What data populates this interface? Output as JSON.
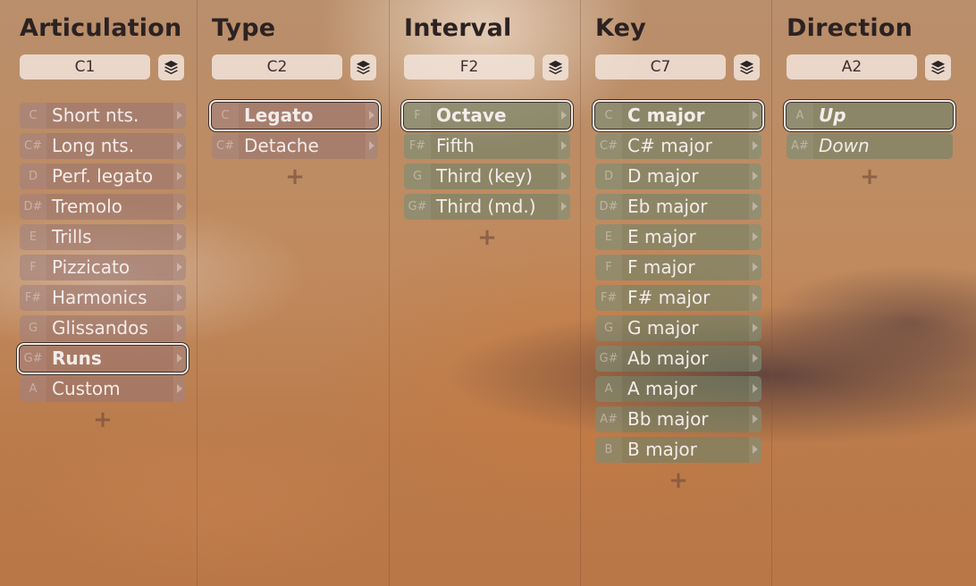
{
  "columns": [
    {
      "title": "Articulation",
      "trigger": "C1",
      "items": [
        {
          "note": "C",
          "label": "Short nts."
        },
        {
          "note": "C#",
          "label": "Long nts."
        },
        {
          "note": "D",
          "label": "Perf. legato"
        },
        {
          "note": "D#",
          "label": "Tremolo"
        },
        {
          "note": "E",
          "label": "Trills"
        },
        {
          "note": "F",
          "label": "Pizzicato"
        },
        {
          "note": "F#",
          "label": "Harmonics"
        },
        {
          "note": "G",
          "label": "Glissandos"
        },
        {
          "note": "G#",
          "label": "Runs"
        },
        {
          "note": "A",
          "label": "Custom"
        }
      ],
      "selected_index": 8
    },
    {
      "title": "Type",
      "trigger": "C2",
      "items": [
        {
          "note": "C",
          "label": "Legato"
        },
        {
          "note": "C#",
          "label": "Detache"
        }
      ],
      "selected_index": 0
    },
    {
      "title": "Interval",
      "trigger": "F2",
      "items": [
        {
          "note": "F",
          "label": "Octave"
        },
        {
          "note": "F#",
          "label": "Fifth"
        },
        {
          "note": "G",
          "label": "Third (key)"
        },
        {
          "note": "G#",
          "label": "Third (md.)"
        }
      ],
      "selected_index": 0
    },
    {
      "title": "Key",
      "trigger": "C7",
      "items": [
        {
          "note": "C",
          "label": "C major"
        },
        {
          "note": "C#",
          "label": "C# major"
        },
        {
          "note": "D",
          "label": "D major"
        },
        {
          "note": "D#",
          "label": "Eb major"
        },
        {
          "note": "E",
          "label": "E major"
        },
        {
          "note": "F",
          "label": "F major"
        },
        {
          "note": "F#",
          "label": "F# major"
        },
        {
          "note": "G",
          "label": "G major"
        },
        {
          "note": "G#",
          "label": "Ab major"
        },
        {
          "note": "A",
          "label": "A major"
        },
        {
          "note": "A#",
          "label": "Bb major"
        },
        {
          "note": "B",
          "label": "B major"
        }
      ],
      "selected_index": 0
    },
    {
      "title": "Direction",
      "trigger": "A2",
      "items": [
        {
          "note": "A",
          "label": "Up"
        },
        {
          "note": "A#",
          "label": "Down"
        }
      ],
      "selected_index": 0
    }
  ],
  "icons": {
    "layers": "layers-icon",
    "add": "plus-icon",
    "submenu": "chevron-right-icon"
  },
  "add_symbol": "+",
  "colors": {
    "articulation_item": "#96737380",
    "switch_item": "#6e826980",
    "selected_border": "#f2ece6",
    "title_text": "#2c2222"
  }
}
